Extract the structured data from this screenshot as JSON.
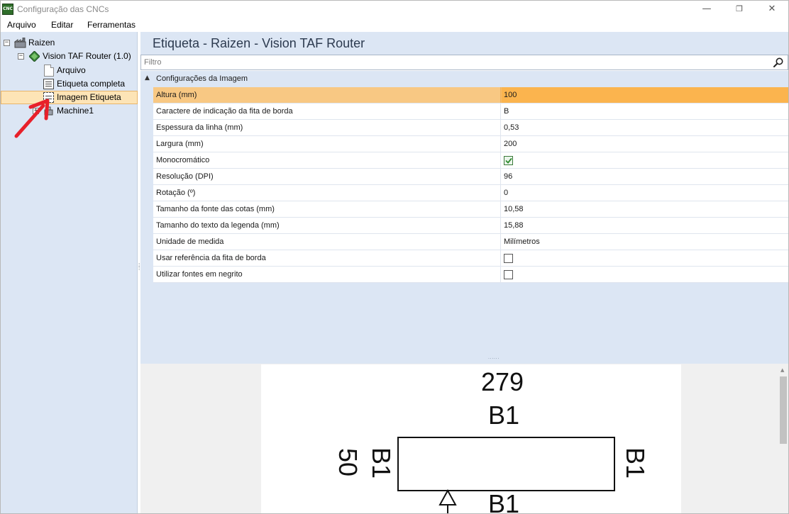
{
  "window": {
    "title": "Configuração das CNCs",
    "app_icon_text": "CNC",
    "controls": {
      "minimize": "—",
      "maximize": "❐",
      "close": "✕"
    }
  },
  "menu": {
    "items": [
      "Arquivo",
      "Editar",
      "Ferramentas"
    ]
  },
  "tree": {
    "root": {
      "label": "Raizen",
      "expander": "−"
    },
    "machine": {
      "label": "Vision TAF Router (1.0)",
      "expander": "−"
    },
    "children": [
      {
        "label": "Arquivo"
      },
      {
        "label": "Etiqueta completa"
      },
      {
        "label": "Imagem Etiqueta",
        "selected": true
      }
    ],
    "machine1": {
      "label": "Machine1",
      "expander": "+"
    }
  },
  "header": {
    "title": "Etiqueta - Raizen - Vision TAF Router"
  },
  "filter": {
    "placeholder": "Filtro",
    "value": ""
  },
  "category": {
    "label": "Configurações da Imagem",
    "expanded": true
  },
  "properties": [
    {
      "name": "Altura (mm)",
      "value": "100",
      "highlight": true
    },
    {
      "name": "Caractere de indicação da fita de borda",
      "value": "B"
    },
    {
      "name": "Espessura da linha (mm)",
      "value": "0,53"
    },
    {
      "name": "Largura (mm)",
      "value": "200"
    },
    {
      "name": "Monocromático",
      "type": "checkbox",
      "checked": true
    },
    {
      "name": "Resolução (DPI)",
      "value": "96"
    },
    {
      "name": "Rotação (º)",
      "value": "0"
    },
    {
      "name": "Tamanho da fonte das cotas (mm)",
      "value": "10,58"
    },
    {
      "name": "Tamanho do texto da legenda (mm)",
      "value": "15,88"
    },
    {
      "name": "Unidade de medida",
      "value": "Milímetros"
    },
    {
      "name": "Usar referência da fita de borda",
      "type": "checkbox",
      "checked": false
    },
    {
      "name": "Utilizar fontes em negrito",
      "type": "checkbox",
      "checked": false
    }
  ],
  "preview": {
    "dimension_top": "279",
    "edge_top": "B1",
    "edge_bottom": "B1",
    "dimension_left": "50",
    "edge_left": "B1",
    "edge_right": "B1"
  },
  "colors": {
    "panel_bg": "#dce6f4",
    "selection": "#fde4b6",
    "highlight_row": "#fbb44e",
    "annotation_arrow": "#e8202a"
  }
}
